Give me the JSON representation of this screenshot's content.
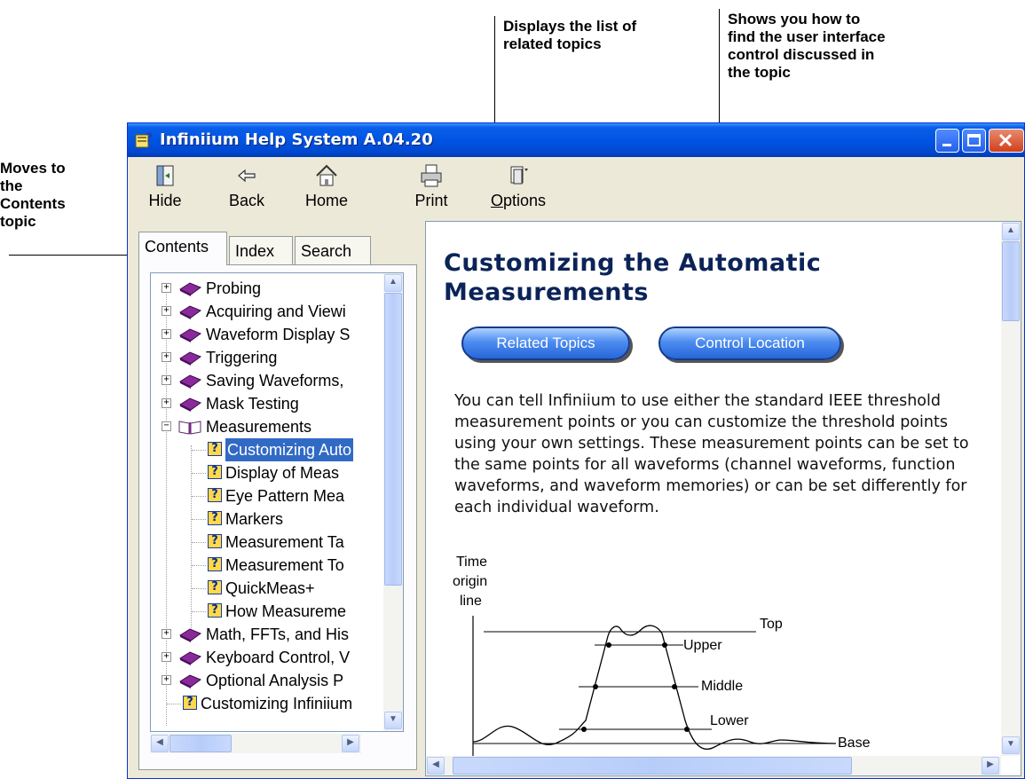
{
  "callouts": {
    "contents": "Moves to\nthe\nContents\ntopic",
    "related": "Displays the list of\nrelated topics",
    "control": "Shows you how to\nfind the user interface\ncontrol discussed in\nthe topic"
  },
  "window": {
    "title": "Infiniium Help System A.04.20"
  },
  "toolbar": {
    "hide": "Hide",
    "back": "Back",
    "home": "Home",
    "print": "Print",
    "options": "Options"
  },
  "nav": {
    "tabs": [
      "Contents",
      "Index",
      "Search"
    ],
    "active_tab": "Contents",
    "tree": [
      {
        "type": "book",
        "label": "Probing"
      },
      {
        "type": "book",
        "label": "Acquiring and Viewi"
      },
      {
        "type": "book",
        "label": "Waveform Display S"
      },
      {
        "type": "book",
        "label": "Triggering"
      },
      {
        "type": "book",
        "label": "Saving Waveforms,"
      },
      {
        "type": "book",
        "label": "Mask Testing"
      },
      {
        "type": "book-open",
        "label": "Measurements"
      },
      {
        "type": "topic",
        "label": "Customizing Auto",
        "selected": true
      },
      {
        "type": "topic",
        "label": "Display of Meas"
      },
      {
        "type": "topic",
        "label": "Eye Pattern Mea"
      },
      {
        "type": "topic",
        "label": "Markers"
      },
      {
        "type": "topic",
        "label": "Measurement Ta"
      },
      {
        "type": "topic",
        "label": "Measurement To"
      },
      {
        "type": "topic",
        "label": "QuickMeas+"
      },
      {
        "type": "topic",
        "label": "How Measureme"
      },
      {
        "type": "book",
        "label": "Math, FFTs, and His"
      },
      {
        "type": "book",
        "label": "Keyboard Control, V"
      },
      {
        "type": "book",
        "label": "Optional Analysis P"
      },
      {
        "type": "topic",
        "label": "Customizing Infiniium"
      }
    ]
  },
  "content": {
    "title": "Customizing the Automatic Measurements",
    "buttons": {
      "related": "Related Topics",
      "control": "Control Location"
    },
    "paragraph": "You can tell Infiniium to use either the standard IEEE threshold measurement points or you can customize the threshold points using your own settings. These measurement points can be set to the same points for all waveforms (channel waveforms, function waveforms, and waveform memories) or can be set differently for each individual waveform.",
    "diagram": {
      "origin_label": [
        "Time",
        "origin",
        "line"
      ],
      "top": "Top",
      "upper": "Upper",
      "middle": "Middle",
      "lower": "Lower",
      "base": "Base"
    }
  },
  "colors": {
    "title_bar": "#0054e3",
    "selection": "#316ac5",
    "topic_title": "#0b2358"
  }
}
